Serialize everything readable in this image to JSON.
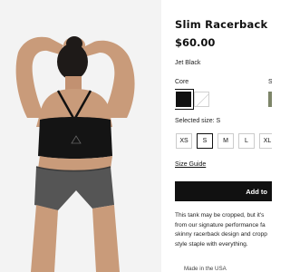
{
  "product": {
    "title": "Slim Racerback Cr",
    "price": "$60.00",
    "color_name": "Jet Black"
  },
  "swatches": {
    "core_label": "Core",
    "second_label": "S",
    "colors": {
      "black": "#111111",
      "white": "#ffffff",
      "olive": "#7d8569"
    }
  },
  "sizes": {
    "selected_label": "Selected size: S",
    "options": [
      "XS",
      "S",
      "M",
      "L",
      "XL"
    ],
    "selected": "S"
  },
  "size_guide": "Size Guide",
  "add_button": "Add to",
  "description": [
    "This tank may be cropped, but it's",
    "from our signature performance fa",
    "skinny racerback design and cropp",
    "style staple with everything."
  ],
  "footer_partial": "Made in the USA",
  "icons": {
    "tank_logo": "triangle-logo-icon"
  }
}
